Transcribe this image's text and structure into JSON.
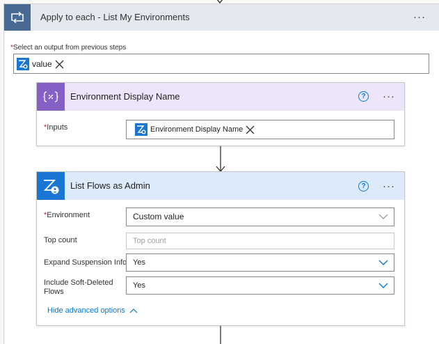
{
  "loop": {
    "title": "Apply to each - List My Environments",
    "more": "···",
    "required_mark": "*",
    "select_label": "Select an output from previous steps",
    "token_label": "value"
  },
  "compose": {
    "title": "Environment Display Name",
    "help": "?",
    "more": "···",
    "required_mark": "*",
    "inputs_label": "Inputs",
    "token_label": "Environment Display Name"
  },
  "list_flows": {
    "title": "List Flows as Admin",
    "help": "?",
    "more": "···",
    "required_mark": "*",
    "environment_label": "Environment",
    "environment_value": "Custom value",
    "top_count_label": "Top count",
    "top_count_placeholder": "Top count",
    "expand_label": "Expand Suspension Info",
    "expand_value": "Yes",
    "soft_deleted_label": "Include Soft-Deleted Flows",
    "soft_deleted_value": "Yes",
    "hide_advanced": "Hide advanced options"
  },
  "colors": {
    "loop_header_bg": "#e4e9f0",
    "loop_icon_bg": "#486991",
    "compose_header_bg": "#ede6fb",
    "compose_icon_bg": "#8661c5",
    "connector_header_bg": "#dceaf9",
    "connector_icon_bg": "#1976d2",
    "link": "#0078d4"
  },
  "icons": {
    "loop": "loop-icon",
    "compose": "compose-icon",
    "connector": "flow-admin-icon",
    "remove": "close-icon",
    "chevron": "chevron-down-icon"
  }
}
